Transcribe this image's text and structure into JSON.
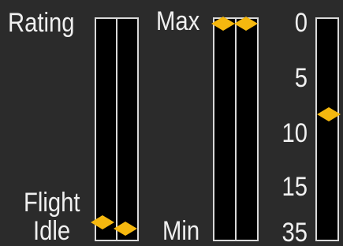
{
  "rating_gauge": {
    "top_label": "Rating",
    "bottom_label_line1": "Flight",
    "bottom_label_line2": "Idle",
    "markers": [
      {
        "name": "engine-1",
        "level": 0.06
      },
      {
        "name": "engine-2",
        "level": 0.03
      }
    ]
  },
  "minmax_gauge": {
    "top_label": "Max",
    "bottom_label": "Min",
    "markers": [
      {
        "name": "engine-1",
        "level": 1.0
      },
      {
        "name": "engine-2",
        "level": 1.0
      }
    ]
  },
  "scale_gauge": {
    "ticks": [
      "0",
      "5",
      "10",
      "15",
      "35"
    ],
    "marker": {
      "value": 8.5,
      "level": 0.57
    }
  },
  "colors": {
    "marker": "#f5b80f",
    "track": "#000000",
    "border": "#d9d9d9",
    "background": "#2b2b2b",
    "text": "#f0f0f0"
  }
}
